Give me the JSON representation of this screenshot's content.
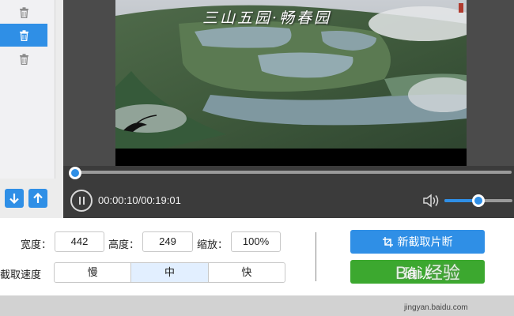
{
  "list": {
    "rows": [
      {
        "icon": "trash-icon",
        "selected": false
      },
      {
        "icon": "trash-icon",
        "selected": true
      },
      {
        "icon": "trash-icon",
        "selected": false
      }
    ],
    "move_down_icon": "arrow-down-icon",
    "move_up_icon": "arrow-up-icon"
  },
  "player": {
    "video_title": "三山五园·畅春园",
    "timecode": "00:00:10/00:19:01",
    "progress_fraction": 0.009,
    "volume_fraction": 0.5
  },
  "settings": {
    "width_label": "宽度：",
    "width_value": "442",
    "height_label": "高度：",
    "height_value": "249",
    "zoom_label": "缩放：",
    "zoom_value": "100%",
    "speed_label": "截取速度",
    "speed_options": [
      "慢",
      "中",
      "快"
    ],
    "speed_selected": "中"
  },
  "actions": {
    "new_clip_label": "新截取片断",
    "confirm_label": "确认"
  },
  "watermark": {
    "text": "Bai 经验",
    "url": "jingyan.baidu.com"
  },
  "colors": {
    "accent": "#2f8fe6",
    "confirm": "#3ca82f",
    "player_bg": "#3b3b3b"
  }
}
